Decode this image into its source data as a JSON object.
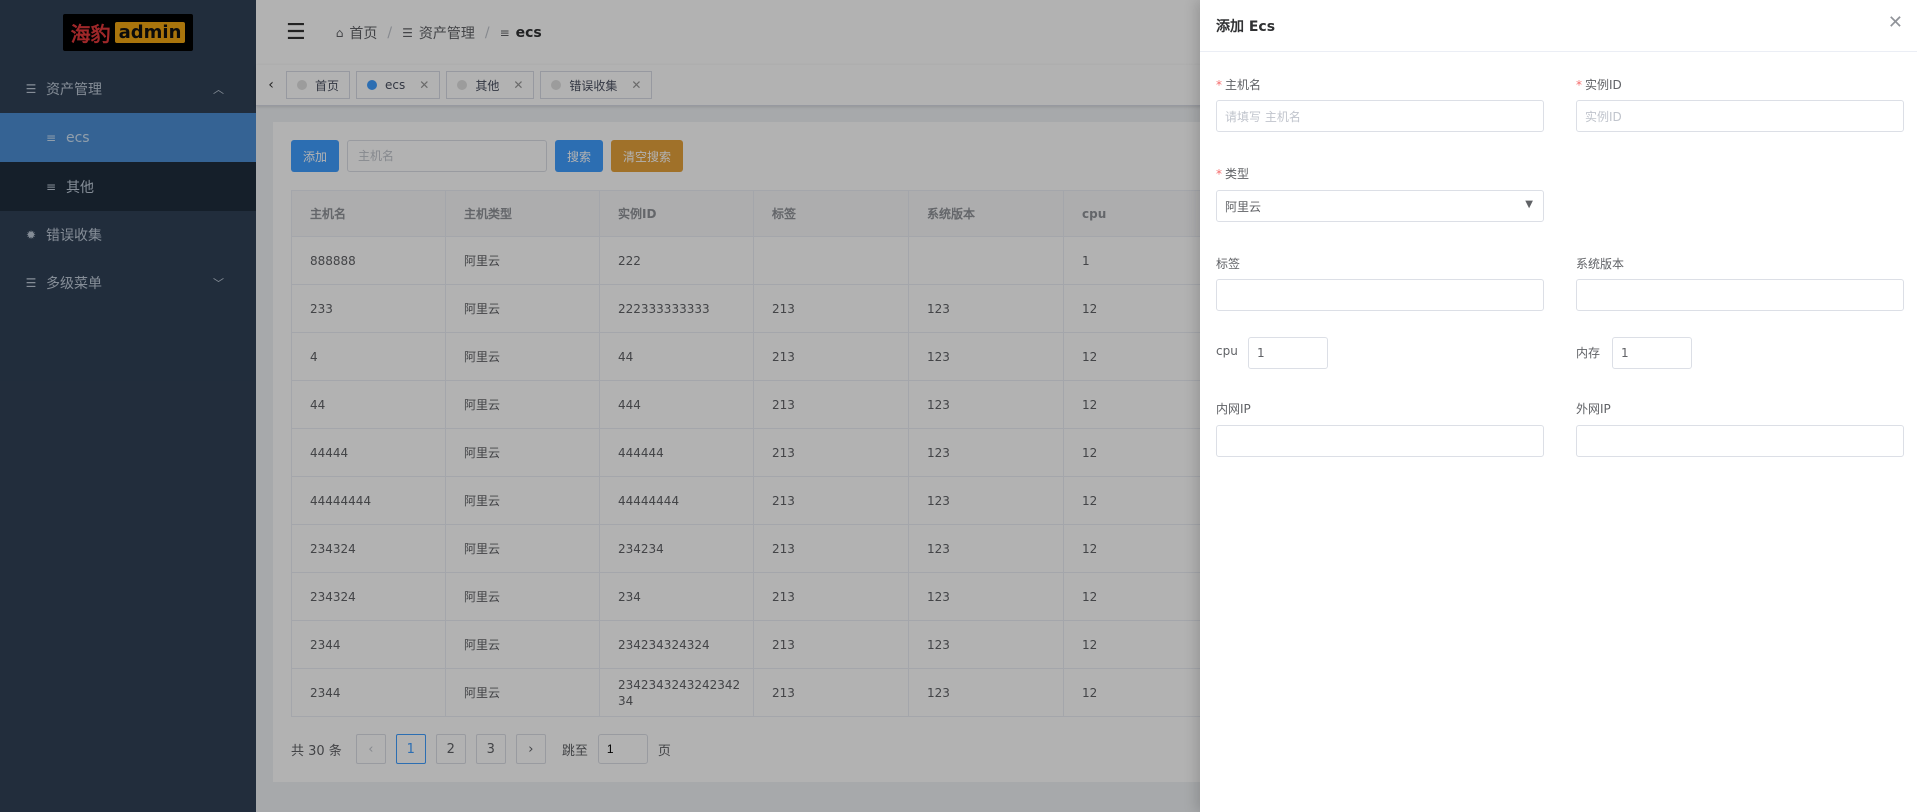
{
  "sidebar": {
    "logo_cn": "海豹",
    "logo_en": "admin",
    "items": [
      {
        "label": "资产管理",
        "icon": "list-icon"
      },
      {
        "label": "ecs",
        "icon": "filter-icon"
      },
      {
        "label": "其他",
        "icon": "filter-icon"
      },
      {
        "label": "错误收集",
        "icon": "bug-icon"
      },
      {
        "label": "多级菜单",
        "icon": "list-icon"
      }
    ]
  },
  "header": {
    "breadcrumb": [
      "首页",
      "资产管理",
      "ecs"
    ]
  },
  "tags": [
    {
      "label": "首页"
    },
    {
      "label": "ecs"
    },
    {
      "label": "其他"
    },
    {
      "label": "错误收集"
    }
  ],
  "toolbar": {
    "add_label": "添加",
    "search_placeholder": "主机名",
    "search_label": "搜索",
    "clear_label": "清空搜索"
  },
  "table": {
    "columns": [
      "主机名",
      "主机类型",
      "实例ID",
      "标签",
      "系统版本",
      "cpu"
    ],
    "rows": [
      [
        "888888",
        "阿里云",
        "222",
        "",
        "",
        "1"
      ],
      [
        "233",
        "阿里云",
        "222333333333",
        "213",
        "123",
        "12"
      ],
      [
        "4",
        "阿里云",
        "44",
        "213",
        "123",
        "12"
      ],
      [
        "44",
        "阿里云",
        "444",
        "213",
        "123",
        "12"
      ],
      [
        "44444",
        "阿里云",
        "444444",
        "213",
        "123",
        "12"
      ],
      [
        "44444444",
        "阿里云",
        "44444444",
        "213",
        "123",
        "12"
      ],
      [
        "234324",
        "阿里云",
        "234234",
        "213",
        "123",
        "12"
      ],
      [
        "234324",
        "阿里云",
        "234",
        "213",
        "123",
        "12"
      ],
      [
        "2344",
        "阿里云",
        "234234324324",
        "213",
        "123",
        "12"
      ],
      [
        "2344",
        "阿里云",
        "234234324324234234",
        "213",
        "123",
        "12"
      ]
    ]
  },
  "pager": {
    "total": "共 30 条",
    "pages": [
      "1",
      "2",
      "3"
    ],
    "jump_label": "跳至",
    "jump_value": "1",
    "page_suffix": "页"
  },
  "drawer": {
    "title": "添加 Ecs",
    "hostname_label": "主机名",
    "hostname_placeholder": "请填写 主机名",
    "instance_label": "实例ID",
    "instance_placeholder": "实例ID",
    "type_label": "类型",
    "type_value": "阿里云",
    "tag_label": "标签",
    "os_label": "系统版本",
    "cpu_label": "cpu",
    "cpu_value": "1",
    "mem_label": "内存",
    "mem_value": "1",
    "lan_ip_label": "内网IP",
    "wan_ip_label": "外网IP"
  },
  "colors": {
    "sidebar_bg": "#304156",
    "primary": "#409eff",
    "warning": "#e6a23c",
    "required": "#f56c6c"
  }
}
